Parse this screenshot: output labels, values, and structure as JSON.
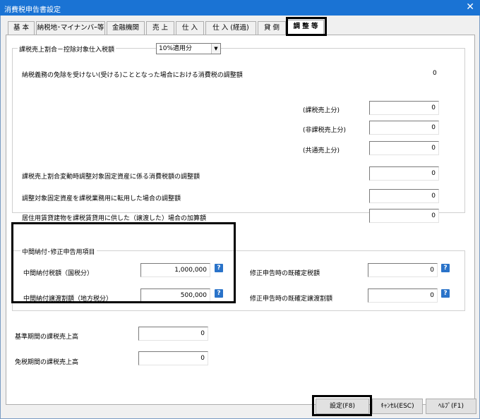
{
  "window": {
    "title": "消費税申告書設定",
    "close_glyph": "✕"
  },
  "tabs": [
    {
      "label": "基 本"
    },
    {
      "label": "納税地･マイナンバｰ等"
    },
    {
      "label": "金融機関"
    },
    {
      "label": "売 上"
    },
    {
      "label": "仕 入"
    },
    {
      "label": "仕 入 (経過)"
    },
    {
      "label": "貸 倒"
    },
    {
      "label": "調 整 等"
    }
  ],
  "adjust_group": {
    "legend": "課税売上割合－控除対象仕入税額",
    "select_value": "10%適用分",
    "exemption_label": "納税義務の免除を受けない(受ける)こととなった場合における消費税の調整額",
    "exemption_value": "0",
    "taxable_sub_label": "(課税売上分)",
    "taxable_sub_value": "0",
    "nontaxable_sub_label": "(非課税売上分)",
    "nontaxable_sub_value": "0",
    "common_sub_label": "(共通売上分)",
    "common_sub_value": "0",
    "ratio_change_label": "課税売上割合変動時調整対象固定資産に係る消費税額の調整額",
    "ratio_change_value": "0",
    "conversion_label": "調整対象固定資産を課税業務用に転用した場合の調整額",
    "conversion_value": "0",
    "residential_label": "居住用賃貸建物を課税賃貸用に供した（譲渡した）場合の加算額",
    "residential_value": "0"
  },
  "interim_group": {
    "legend": "中間納付･修正申告用項目",
    "national_tax_label": "中間納付税額（国税分）",
    "national_tax_value": "1,000,000",
    "local_tax_label": "中間納付譲渡割額（地方税分）",
    "local_tax_value": "500,000",
    "amend_tax_label": "修正申告時の既確定税額",
    "amend_tax_value": "0",
    "amend_transfer_label": "修正申告時の既確定譲渡割額",
    "amend_transfer_value": "0",
    "help_glyph": "?"
  },
  "base_period_label": "基準期間の課税売上高",
  "base_period_value": "0",
  "exempt_period_label": "免税期間の課税売上高",
  "exempt_period_value": "0",
  "buttons": {
    "ok": "設定(F8)",
    "cancel": "ｷｬﾝｾﾙ(ESC)",
    "help": "ﾍﾙﾌﾟ(F1)"
  }
}
